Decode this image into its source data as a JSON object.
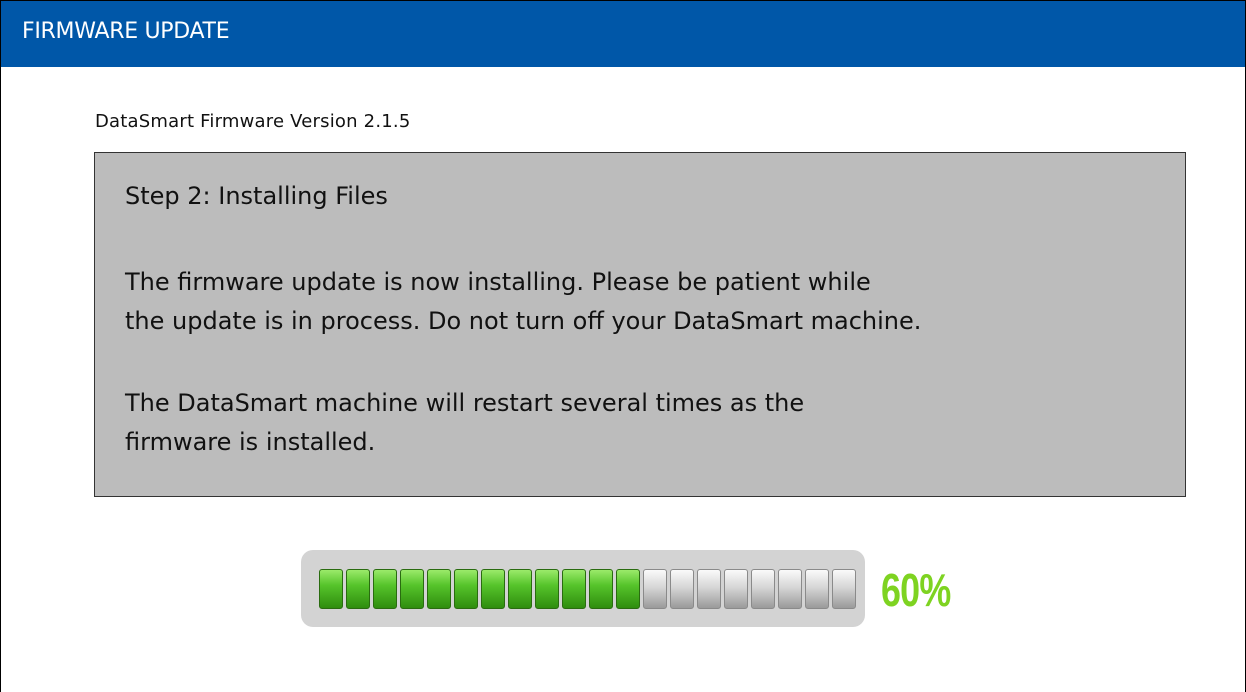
{
  "window": {
    "title": "FIRMWARE UPDATE",
    "accent_color": "#0057a8"
  },
  "version_text": "DataSmart Firmware Version 2.1.5",
  "info": {
    "step_title": "Step 2: Installing Files",
    "paragraph1": [
      "The firmware update is now installing. Please be patient while",
      "the update is in process. Do not turn off your DataSmart machine."
    ],
    "paragraph2": [
      "The DataSmart machine will restart several times as the",
      "firmware is installed."
    ]
  },
  "progress": {
    "percent": 60,
    "label": "60%",
    "segments_total": 20,
    "fill_color": "#56c42b",
    "label_color": "#7ed321"
  }
}
